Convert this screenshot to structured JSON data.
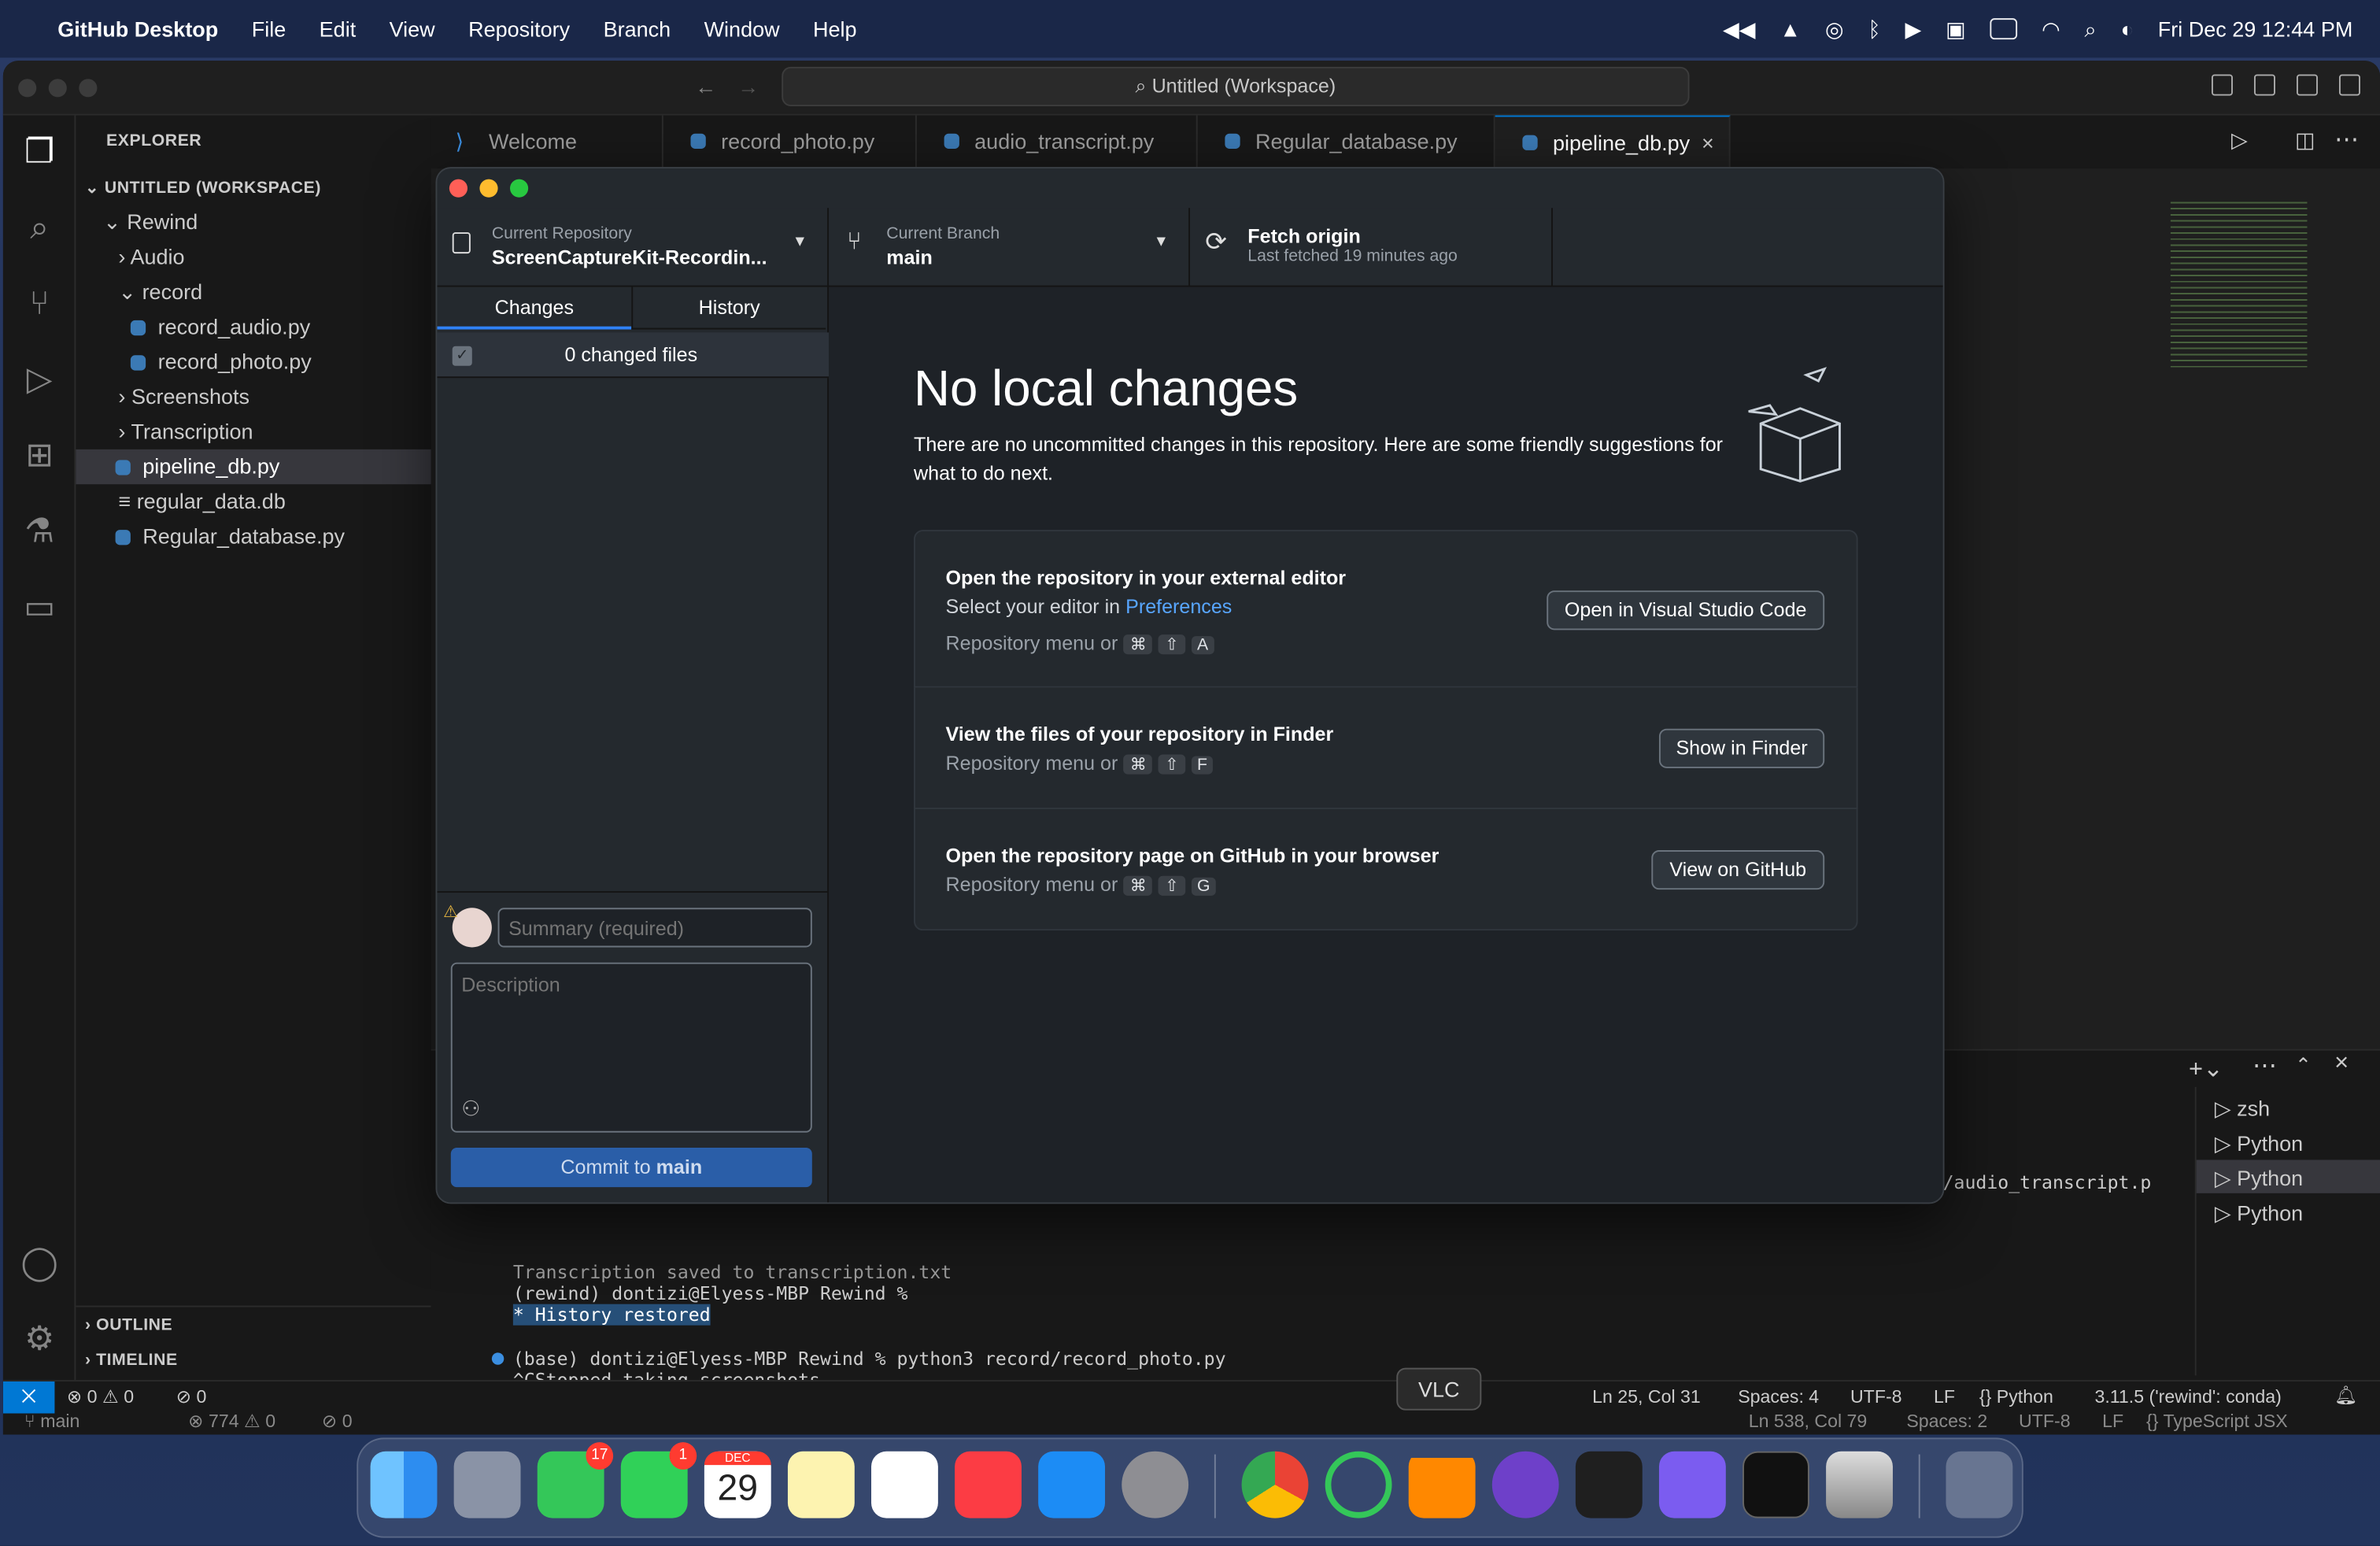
{
  "menubar": {
    "app": "GitHub Desktop",
    "items": [
      "File",
      "Edit",
      "View",
      "Repository",
      "Branch",
      "Window",
      "Help"
    ],
    "clock": "Fri Dec 29  12:44 PM"
  },
  "vscode": {
    "command_center": "Untitled (Workspace)",
    "explorer": {
      "title": "EXPLORER",
      "workspace": "UNTITLED (WORKSPACE)",
      "tree": [
        {
          "label": "Rewind",
          "kind": "folder-open"
        },
        {
          "label": "Audio",
          "kind": "folder"
        },
        {
          "label": "record",
          "kind": "folder-open"
        },
        {
          "label": "record_audio.py",
          "kind": "py"
        },
        {
          "label": "record_photo.py",
          "kind": "py"
        },
        {
          "label": "Screenshots",
          "kind": "folder"
        },
        {
          "label": "Transcription",
          "kind": "folder"
        },
        {
          "label": "pipeline_db.py",
          "kind": "py"
        },
        {
          "label": "regular_data.db",
          "kind": "file"
        },
        {
          "label": "Regular_database.py",
          "kind": "py"
        }
      ],
      "outline": "OUTLINE",
      "timeline": "TIMELINE"
    },
    "tabs": [
      "Welcome",
      "record_photo.py",
      "audio_transcript.py",
      "Regular_database.py",
      "pipeline_db.py"
    ],
    "terminal": {
      "lines": [
        "Transcription saved to transcription.txt",
        "(rewind) dontizi@Elyess-MBP Rewind %",
        "History restored",
        "(base) dontizi@Elyess-MBP Rewind % python3 record/record_photo.py",
        "^CStopped taking screenshots.",
        "(base) dontizi@Elyess-MBP Rewind % python3 record/record_photo.py"
      ],
      "partial": "/audio_transcript.p",
      "sessions": [
        "zsh",
        "Python",
        "Python",
        "Python"
      ]
    },
    "status": {
      "errors": "0",
      "warnings": "0",
      "ports": "0",
      "position": "Ln 25, Col 31",
      "spaces": "Spaces: 4",
      "encoding": "UTF-8",
      "eol": "LF",
      "language": "Python",
      "interpreter": "3.11.5 ('rewind': conda)"
    },
    "status2": {
      "branch": "main",
      "errors": "774",
      "warnings": "0",
      "ports": "0",
      "position": "Ln 538, Col 79",
      "spaces": "Spaces: 2",
      "encoding": "UTF-8",
      "eol": "LF",
      "language": "TypeScript JSX"
    }
  },
  "github": {
    "repo_label": "Current Repository",
    "repo": "ScreenCaptureKit-Recordin...",
    "branch_label": "Current Branch",
    "branch": "main",
    "fetch": "Fetch origin",
    "fetch_sub": "Last fetched 19 minutes ago",
    "tabs": [
      "Changes",
      "History"
    ],
    "changed": "0 changed files",
    "summary_placeholder": "Summary (required)",
    "description_placeholder": "Description",
    "commit_prefix": "Commit to",
    "commit_branch": "main",
    "heading": "No local changes",
    "intro": "There are no uncommitted changes in this repository. Here are some friendly suggestions for what to do next.",
    "cards": [
      {
        "title": "Open the repository in your external editor",
        "sub_prefix": "Select your editor in",
        "sub_link": "Preferences",
        "menu": "Repository menu or",
        "keys": [
          "⌘",
          "⇧",
          "A"
        ],
        "button": "Open in Visual Studio Code"
      },
      {
        "title": "View the files of your repository in Finder",
        "menu": "Repository menu or",
        "keys": [
          "⌘",
          "⇧",
          "F"
        ],
        "button": "Show in Finder"
      },
      {
        "title": "Open the repository page on GitHub in your browser",
        "menu": "Repository menu or",
        "keys": [
          "⌘",
          "⇧",
          "G"
        ],
        "button": "View on GitHub"
      }
    ]
  },
  "dock": {
    "tooltip": "VLC",
    "badges": {
      "messages": "17",
      "facetime": "1"
    },
    "calendar": {
      "month": "DEC",
      "day": "29"
    }
  }
}
